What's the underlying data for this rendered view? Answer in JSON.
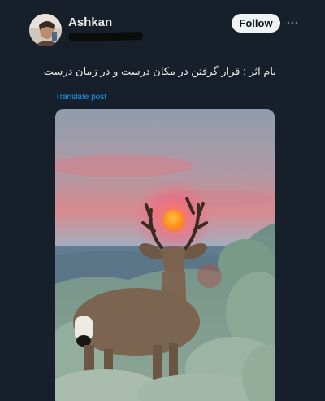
{
  "post": {
    "username": "Ashkan",
    "follow_label": "Follow",
    "text": "نام اثر : قرار گرفتن در مکان درست و در زمان درست",
    "translate_label": "Translate post"
  },
  "icons": {
    "more": "more-horizontal-icon",
    "avatar": "avatar-photo"
  },
  "colors": {
    "background": "#17202a",
    "follow_button": "#eff3f4",
    "link": "#1d9bf0",
    "sun": "#ff6a2a"
  }
}
